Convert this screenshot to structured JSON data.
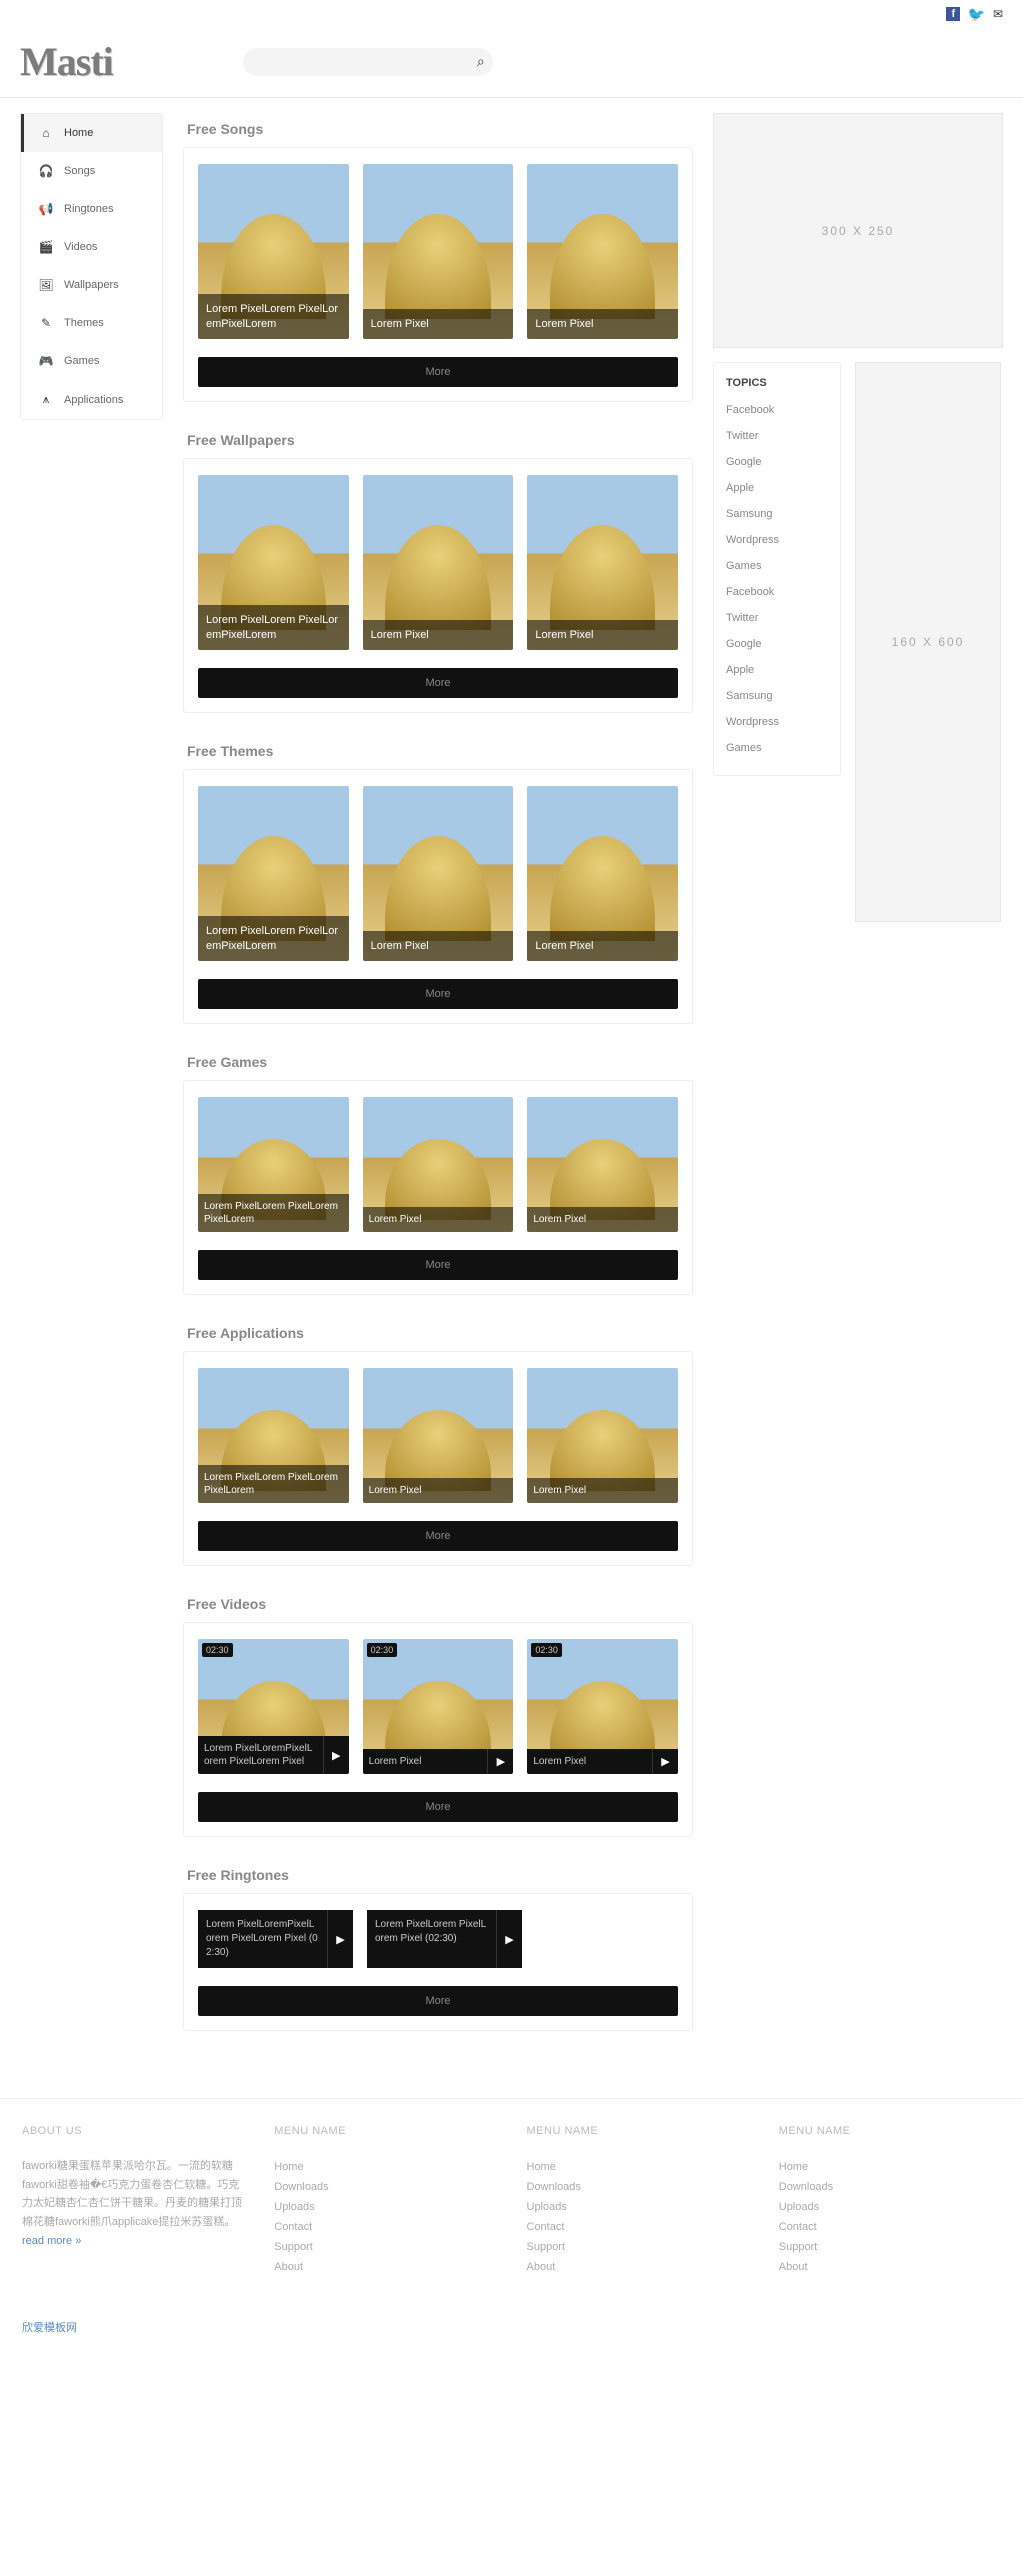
{
  "brand": "Masti",
  "search": {
    "placeholder": ""
  },
  "nav": [
    {
      "icon": "⌂",
      "label": "Home",
      "active": true
    },
    {
      "icon": "🎧",
      "label": "Songs"
    },
    {
      "icon": "📢",
      "label": "Ringtones"
    },
    {
      "icon": "🎬",
      "label": "Videos"
    },
    {
      "icon": "🖼",
      "label": "Wallpapers"
    },
    {
      "icon": "✎",
      "label": "Themes"
    },
    {
      "icon": "🎮",
      "label": "Games"
    },
    {
      "icon": "⩚",
      "label": "Applications"
    }
  ],
  "panels": [
    {
      "title": "Free Songs",
      "style": "img",
      "items": [
        "Lorem PixelLorem PixelLoremPixelLorem",
        "Lorem Pixel",
        "Lorem Pixel"
      ],
      "more": "More"
    },
    {
      "title": "Free Wallpapers",
      "style": "img",
      "items": [
        "Lorem PixelLorem PixelLoremPixelLorem",
        "Lorem Pixel",
        "Lorem Pixel"
      ],
      "more": "More"
    },
    {
      "title": "Free Themes",
      "style": "img",
      "items": [
        "Lorem PixelLorem PixelLoremPixelLorem",
        "Lorem Pixel",
        "Lorem Pixel"
      ],
      "more": "More"
    },
    {
      "title": "Free Games",
      "style": "imgS",
      "items": [
        "Lorem PixelLorem PixelLoremPixelLorem",
        "Lorem Pixel",
        "Lorem Pixel"
      ],
      "more": "More"
    },
    {
      "title": "Free Applications",
      "style": "imgS",
      "items": [
        "Lorem PixelLorem PixelLoremPixelLorem",
        "Lorem Pixel",
        "Lorem Pixel"
      ],
      "more": "More"
    },
    {
      "title": "Free Videos",
      "style": "vid",
      "badge": "02:30",
      "items": [
        "Lorem PixelLoremPixelLorem PixelLorem Pixel",
        "Lorem Pixel",
        "Lorem Pixel"
      ],
      "more": "More"
    },
    {
      "title": "Free Ringtones",
      "style": "ring",
      "items": [
        "Lorem PixelLoremPixelLorem PixelLorem Pixel (02:30)",
        "Lorem PixelLorem PixelLorem Pixel (02:30)"
      ],
      "more": "More"
    }
  ],
  "ads": {
    "rect": "300 X 250",
    "sky": "160 X 600"
  },
  "topics": {
    "heading": "TOPICS",
    "items": [
      "Facebook",
      "Twitter",
      "Google",
      "Apple",
      "Samsung",
      "Wordpress",
      "Games",
      "Facebook",
      "Twitter",
      "Google",
      "Apple",
      "Samsung",
      "Wordpress",
      "Games"
    ]
  },
  "footer": {
    "about_h": "ABOUT US",
    "about_txt": "faworki糖果蛋糕苹果派哈尔瓦。一流的软糖faworki甜卷袖�€巧克力蛋卷杏仁软糖。巧克力太妃糖杏仁杏仁饼干糖果。丹麦的糖果打顶棉花糖faworki熊爪applicake提拉米苏蛋糕。",
    "about_more": "read more »",
    "menu_h": "MENU NAME",
    "links": [
      "Home",
      "Downloads",
      "Uploads",
      "Contact",
      "Support",
      "About"
    ]
  },
  "credit": "欣爱模板网"
}
